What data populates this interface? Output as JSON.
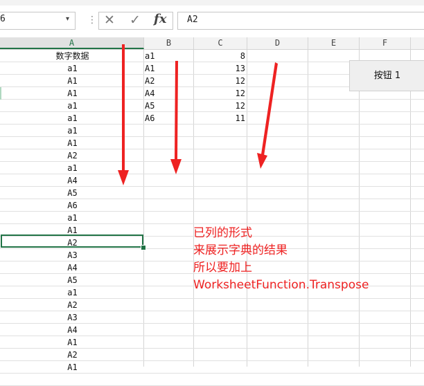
{
  "formula_bar": {
    "name_box_value": "6",
    "cancel_icon": "close-icon",
    "enter_icon": "check-icon",
    "fx_label": "fx",
    "formula_value": "A2"
  },
  "columns": [
    "A",
    "B",
    "C",
    "D",
    "E",
    "F"
  ],
  "column_a": [
    "数字数据",
    "a1",
    "A1",
    "A1",
    "a1",
    "a1",
    "a1",
    "A1",
    "A2",
    "a1",
    "A4",
    "A5",
    "A6",
    "a1",
    "A1",
    "A2",
    "A3",
    "A4",
    "A5",
    "a1",
    "A2",
    "A3",
    "A4",
    "A1",
    "A2",
    "A1"
  ],
  "column_b": [
    "a1",
    "A1",
    "A2",
    "A4",
    "A5",
    "A6"
  ],
  "column_c": [
    "8",
    "13",
    "12",
    "12",
    "12",
    "11"
  ],
  "selected_cell": "A2",
  "button": {
    "label": "按钮 1"
  },
  "annotation": {
    "line1": "已列的形式",
    "line2": "来展示字典的结果",
    "line3": "所以要加上",
    "line4": "WorksheetFunction.Transpose"
  },
  "colors": {
    "arrow": "#ee2222",
    "selection": "#217346",
    "annotation_text": "#ee2222"
  }
}
